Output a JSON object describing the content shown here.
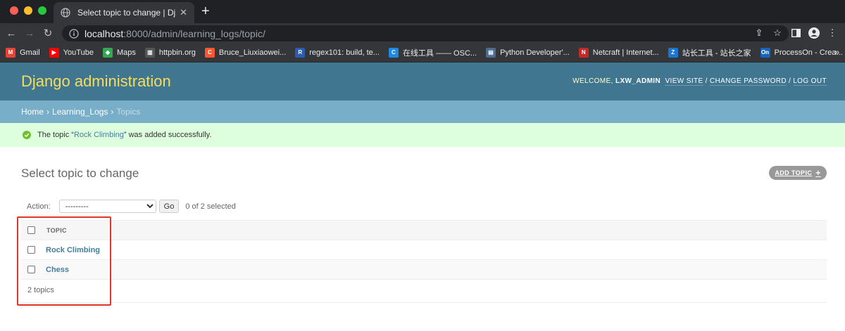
{
  "browser": {
    "tab_title": "Select topic to change | Djang",
    "address": {
      "host": "localhost",
      "rest": ":8000/admin/learning_logs/topic/"
    },
    "bookmarks": [
      {
        "label": "Gmail",
        "icon": "gmail-icon",
        "color": "#ea4335",
        "glyph": "M"
      },
      {
        "label": "YouTube",
        "icon": "youtube-icon",
        "color": "#ff0000",
        "glyph": "▶"
      },
      {
        "label": "Maps",
        "icon": "maps-icon",
        "color": "#34a853",
        "glyph": "◆"
      },
      {
        "label": "httpbin.org",
        "icon": "httpbin-icon",
        "color": "#555555",
        "glyph": "▥"
      },
      {
        "label": "Bruce_Liuxiaowei...",
        "icon": "csdn-icon",
        "color": "#fc5531",
        "glyph": "C"
      },
      {
        "label": "regex101: build, te...",
        "icon": "regex101-icon",
        "color": "#2a5db0",
        "glyph": "R"
      },
      {
        "label": "在线工具 —— OSC...",
        "icon": "oschina-icon",
        "color": "#1e88e5",
        "glyph": "C"
      },
      {
        "label": "Python Developer'...",
        "icon": "python-docs-icon",
        "color": "#4b6b8f",
        "glyph": "▤"
      },
      {
        "label": "Netcraft | Internet...",
        "icon": "netcraft-icon",
        "color": "#c62828",
        "glyph": "N"
      },
      {
        "label": "站长工具 - 站长之家",
        "icon": "chinaz-icon",
        "color": "#1976d2",
        "glyph": "Z"
      },
      {
        "label": "ProcessOn - Crea...",
        "icon": "processon-icon",
        "color": "#1565c0",
        "glyph": "On"
      }
    ]
  },
  "admin": {
    "branding": "Django administration",
    "user_tools": {
      "welcome": "WELCOME, ",
      "username": "LXW_ADMIN",
      "view_site": "VIEW SITE",
      "change_password": "CHANGE PASSWORD",
      "log_out": "LOG OUT"
    },
    "breadcrumbs": {
      "home": "Home",
      "app": "Learning_Logs",
      "current": "Topics"
    },
    "message": {
      "prefix": "The topic “",
      "link": "Rock Climbing",
      "suffix": "” was added successfully."
    },
    "page_title": "Select topic to change",
    "add_button": "ADD TOPIC",
    "actions": {
      "label": "Action:",
      "selected_option": "---------",
      "go": "Go",
      "counter": "0 of 2 selected"
    },
    "table": {
      "column": "TOPIC",
      "rows": [
        "Rock Climbing",
        "Chess"
      ]
    },
    "paginator": "2 topics"
  },
  "colors": {
    "header_bg": "#417690",
    "branding": "#f5dd5d",
    "breadcrumbs_bg": "#79aec8",
    "success_bg": "#ddffdd",
    "link": "#447e9b",
    "highlight": "#e0362a"
  }
}
